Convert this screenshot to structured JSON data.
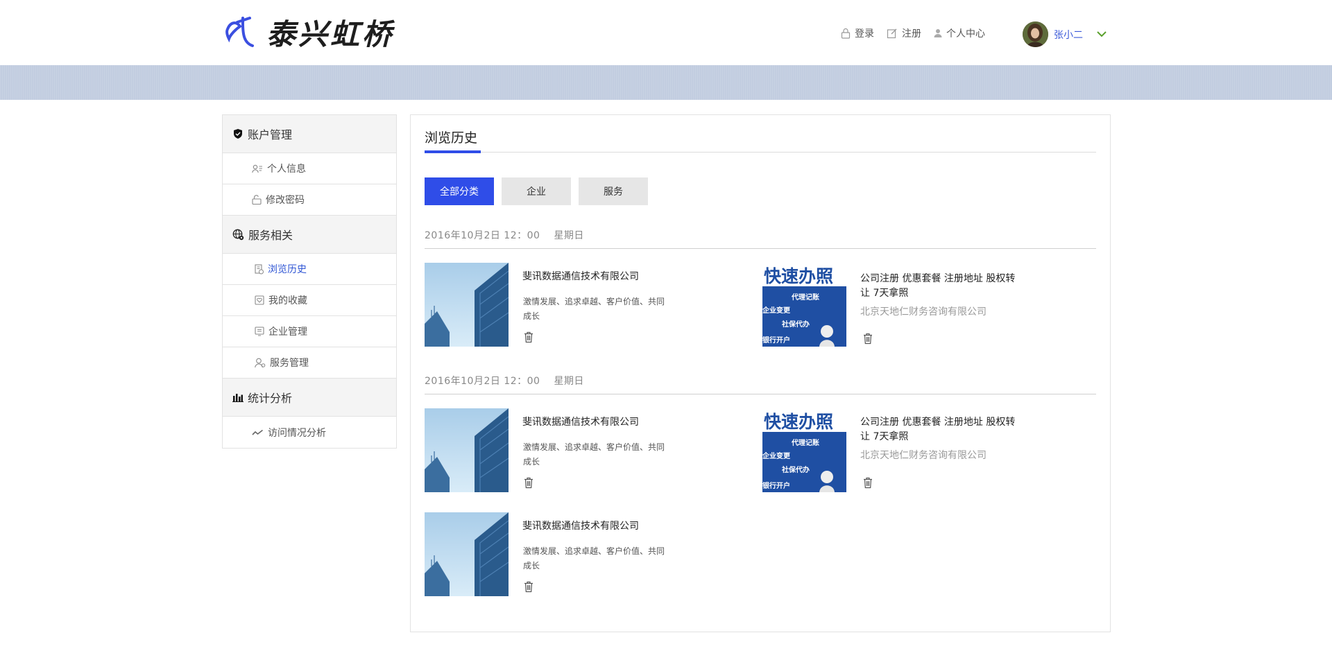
{
  "header": {
    "logo_text": "泰兴虹桥",
    "nav": [
      {
        "label": "登录",
        "icon": "lock-icon"
      },
      {
        "label": "注册",
        "icon": "edit-icon"
      },
      {
        "label": "个人中心",
        "icon": "user-icon"
      }
    ],
    "user_name": "张小二"
  },
  "sidebar": {
    "groups": [
      {
        "label": "账户管理",
        "icon": "shield-icon",
        "items": [
          {
            "label": "个人信息",
            "icon": "user-card-icon"
          },
          {
            "label": "修改密码",
            "icon": "unlock-icon"
          }
        ]
      },
      {
        "label": "服务相关",
        "icon": "globe-gear-icon",
        "items": [
          {
            "label": "浏览历史",
            "icon": "history-doc-icon",
            "active": true
          },
          {
            "label": "我的收藏",
            "icon": "favorite-icon"
          },
          {
            "label": "企业管理",
            "icon": "company-icon"
          },
          {
            "label": "服务管理",
            "icon": "service-user-icon"
          }
        ]
      },
      {
        "label": "统计分析",
        "icon": "bar-chart-icon",
        "items": [
          {
            "label": "访问情况分析",
            "icon": "trend-icon"
          }
        ]
      }
    ]
  },
  "main": {
    "title": "浏览历史",
    "filters": [
      {
        "label": "全部分类",
        "active": true
      },
      {
        "label": "企业",
        "active": false
      },
      {
        "label": "服务",
        "active": false
      }
    ],
    "groups": [
      {
        "date": "2016年10月2日   12：00",
        "weekday": "星期日",
        "company": {
          "name": "斐讯数据通信技术有限公司",
          "desc": "激情发展、追求卓越、客户价值、共同成长"
        },
        "service": {
          "name": "公司注册 优惠套餐 注册地址 股权转让 7天拿照",
          "provider": "北京天地仁财务咨询有限公司",
          "thumb_text": [
            "快速办照",
            "代理记账",
            "企业变更",
            "社保代办",
            "银行开户"
          ]
        }
      },
      {
        "date": "2016年10月2日   12：00",
        "weekday": "星期日",
        "company": {
          "name": "斐讯数据通信技术有限公司",
          "desc": "激情发展、追求卓越、客户价值、共同成长"
        },
        "service": {
          "name": "公司注册 优惠套餐 注册地址 股权转让 7天拿照",
          "provider": "北京天地仁财务咨询有限公司",
          "thumb_text": [
            "快速办照",
            "代理记账",
            "企业变更",
            "社保代办",
            "银行开户"
          ]
        }
      }
    ],
    "extra_company": {
      "name": "斐讯数据通信技术有限公司",
      "desc": "激情发展、追求卓越、客户价值、共同成长"
    }
  },
  "colors": {
    "accent": "#2f4de8",
    "banner": "#c2cde0",
    "active_link": "#2f55d4"
  }
}
